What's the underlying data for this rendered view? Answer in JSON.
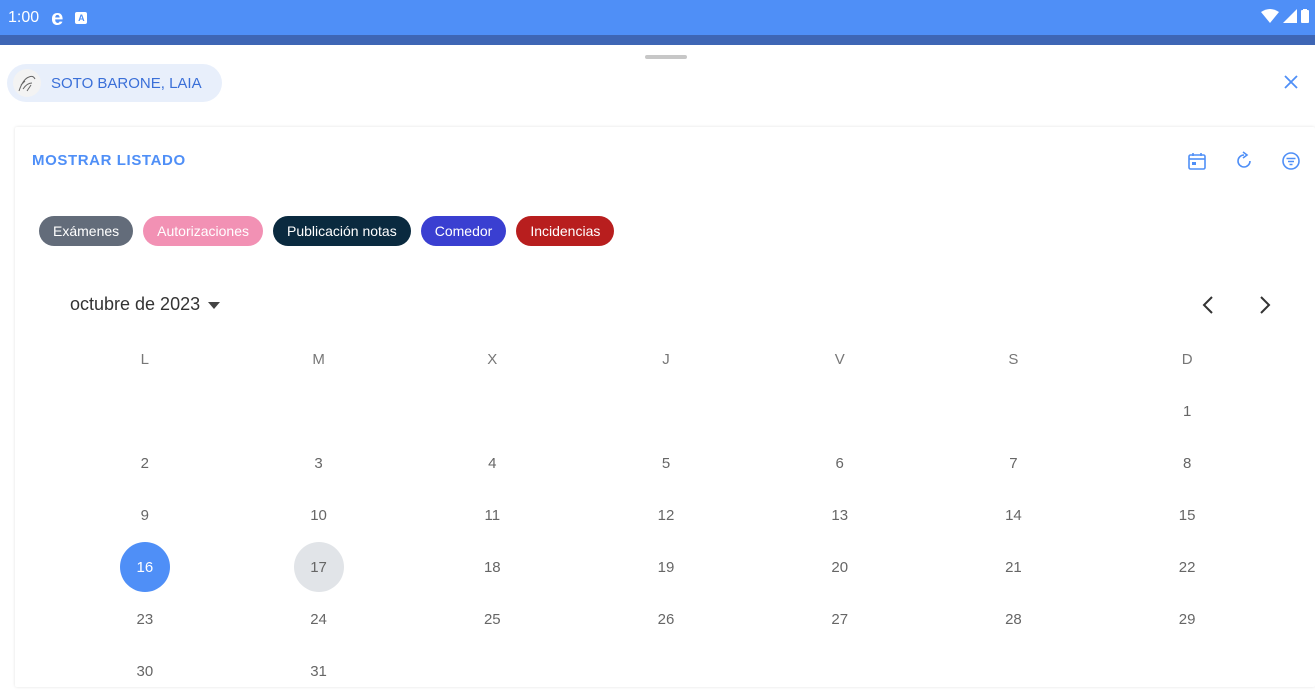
{
  "status_bar": {
    "time": "1:00",
    "app_icon": "e",
    "badge_icon": "A"
  },
  "student": {
    "name": "SOTO BARONE, LAIA"
  },
  "card": {
    "list_toggle_label": "MOSTRAR LISTADO"
  },
  "icons": [
    "calendar-icon",
    "refresh-icon",
    "filter-icon",
    "close-icon",
    "chevron-left-icon",
    "chevron-right-icon"
  ],
  "categories": [
    {
      "label": "Exámenes",
      "color": "#636c7a"
    },
    {
      "label": "Autorizaciones",
      "color": "#f291b4"
    },
    {
      "label": "Publicación notas",
      "color": "#0a2a3f"
    },
    {
      "label": "Comedor",
      "color": "#3a3fd1"
    },
    {
      "label": "Incidencias",
      "color": "#b81e1e"
    }
  ],
  "calendar": {
    "month_label": "octubre de 2023",
    "weekdays": [
      "L",
      "M",
      "X",
      "J",
      "V",
      "S",
      "D"
    ],
    "weeks": [
      [
        "",
        "",
        "",
        "",
        "",
        "",
        "1"
      ],
      [
        "2",
        "3",
        "4",
        "5",
        "6",
        "7",
        "8"
      ],
      [
        "9",
        "10",
        "11",
        "12",
        "13",
        "14",
        "15"
      ],
      [
        "16",
        "17",
        "18",
        "19",
        "20",
        "21",
        "22"
      ],
      [
        "23",
        "24",
        "25",
        "26",
        "27",
        "28",
        "29"
      ],
      [
        "30",
        "31",
        "",
        "",
        "",
        "",
        ""
      ]
    ],
    "selected_day": "16",
    "today": "17"
  },
  "colors": {
    "accent": "#4f8ff7",
    "status_bar": "#4f8ff7",
    "sub_bar": "#3e66b5"
  }
}
